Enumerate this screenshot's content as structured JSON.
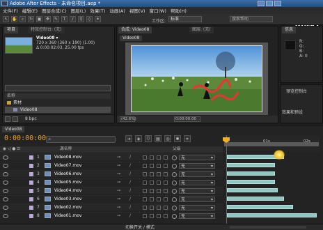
{
  "window": {
    "title": "Adobe After Effects - 未命名项目.aep *"
  },
  "watermark": "优酷",
  "menu": [
    "文件(F)",
    "编辑(E)",
    "图层合成(C)",
    "图层(L)",
    "效果(T)",
    "动画(A)",
    "视图(V)",
    "窗口(W)",
    "帮助(H)"
  ],
  "toolbar": {
    "workspace_label": "工作区:",
    "workspace_value": "标准",
    "search_placeholder": "搜索帮助"
  },
  "project": {
    "tab": "项目",
    "tab2": "特效控制台: (无)",
    "item_name": "Video08 ▾",
    "item_line1": "720 x 360 (360 x 190) (1.00)",
    "item_line2": "Δ 0:00:02:03, 25.00 fps",
    "list_header": "名称",
    "items": [
      {
        "name": "素材"
      },
      {
        "name": "Video08"
      }
    ],
    "footer_bpc": "8 bpc"
  },
  "composition": {
    "tab": "合成: Video08",
    "layer_tab": "图层: (无)",
    "subtab": "Video08",
    "zoom": "(42.6%)",
    "timecode": "0:00:00:00"
  },
  "info": {
    "tab": "信息",
    "channels": [
      "R:",
      "G:",
      "B:",
      "A: 0"
    ]
  },
  "preview": {
    "tab": "预览控制台",
    "tab2": "效果和预设"
  },
  "timeline": {
    "tab": "Video08",
    "timecode": "0:00:00:00",
    "header": {
      "source_name": "源名称",
      "parent": "父级"
    },
    "layers": [
      {
        "num": "1",
        "name": "Video08.mov",
        "parent": "无"
      },
      {
        "num": "2",
        "name": "Video07.mov",
        "parent": "无"
      },
      {
        "num": "3",
        "name": "Video06.mov",
        "parent": "无"
      },
      {
        "num": "4",
        "name": "Video05.mov",
        "parent": "无"
      },
      {
        "num": "5",
        "name": "Video04.mov",
        "parent": "无"
      },
      {
        "num": "6",
        "name": "Video03.mov",
        "parent": "无"
      },
      {
        "num": "7",
        "name": "Video02.mov",
        "parent": "无"
      },
      {
        "num": "8",
        "name": "Video01.mov",
        "parent": "无"
      }
    ],
    "ruler": [
      "0s",
      "01s",
      "02s"
    ],
    "bar_ends_fraction": [
      0.62,
      0.52,
      0.52,
      0.52,
      0.55,
      0.62,
      0.72,
      0.98
    ],
    "footer_label": "切换开关 / 模式"
  },
  "colors": {
    "timecode": "#f0a020",
    "playhead": "#e03020",
    "bar": "#8fc6c2",
    "label": "#b9a9d9"
  }
}
